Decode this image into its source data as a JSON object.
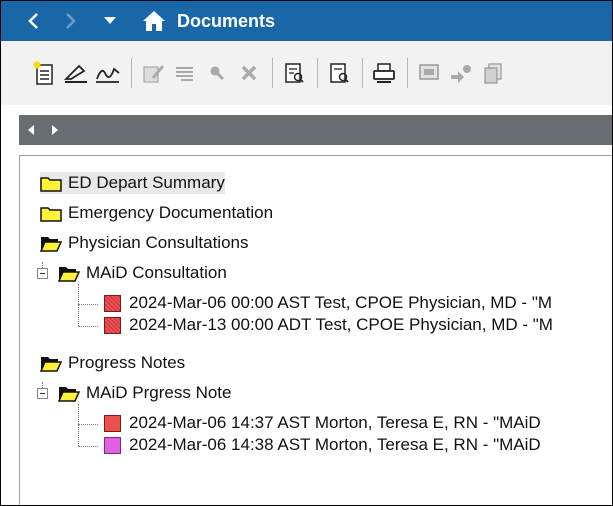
{
  "header": {
    "title": "Documents",
    "back_icon": "back-arrow-icon",
    "forward_icon": "forward-arrow-icon",
    "menu_icon": "dropdown-icon",
    "home_icon": "home-icon"
  },
  "toolbar": {
    "icons": [
      "new-document-icon",
      "sign-icon",
      "forward-signature-icon",
      "edit-icon",
      "notes-icon",
      "search-icon",
      "delete-icon",
      "preview-icon",
      "report-icon",
      "print-icon",
      "display-icon",
      "transfer-icon",
      "copy-icon"
    ]
  },
  "tree": {
    "nodes": [
      {
        "label": "ED Depart Summary",
        "type": "folder-closed"
      },
      {
        "label": "Emergency Documentation",
        "type": "folder-closed"
      },
      {
        "label": "Physician Consultations",
        "type": "folder-open"
      },
      {
        "label": "MAiD Consultation",
        "type": "folder-open"
      },
      {
        "label": "2024-Mar-06 00:00 AST Test, CPOE Physician, MD  - \"M",
        "type": "document",
        "color": "#e0393f"
      },
      {
        "label": "2024-Mar-13 00:00 ADT Test, CPOE Physician, MD  - \"M",
        "type": "document",
        "color": "#e0393f"
      },
      {
        "label": "Progress Notes",
        "type": "folder-open"
      },
      {
        "label": "MAiD Prgress Note",
        "type": "folder-open"
      },
      {
        "label": "2024-Mar-06 14:37 AST Morton, Teresa E, RN  - \"MAiD",
        "type": "document",
        "color": "#e9504e"
      },
      {
        "label": "2024-Mar-06 14:38 AST Morton, Teresa E, RN  - \"MAiD",
        "type": "document",
        "color": "#e060e3"
      }
    ]
  },
  "colors": {
    "header_bg": "#1a67a8",
    "scroll_bg": "#676d71",
    "folder": "#fff33a"
  }
}
